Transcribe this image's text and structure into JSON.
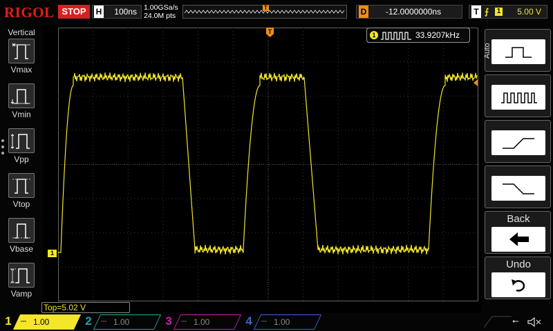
{
  "header": {
    "logo": "RIGOL",
    "run_state": "STOP",
    "horizontal_label": "H",
    "timebase": "100ns",
    "sample_rate": "1.00GSa/s",
    "memory_depth": "24.0M pts",
    "delay_label": "D",
    "delay": "-12.0000000ns",
    "trigger_label": "T",
    "trigger_source": "1",
    "trigger_level": "5.00 V",
    "trigger_marker": "T"
  },
  "measure_panel": {
    "title": "Vertical",
    "items": [
      {
        "label": "Vmax",
        "icon": "vmax-icon"
      },
      {
        "label": "Vmin",
        "icon": "vmin-icon"
      },
      {
        "label": "Vpp",
        "icon": "vpp-icon"
      },
      {
        "label": "Vtop",
        "icon": "vtop-icon"
      },
      {
        "label": "Vbase",
        "icon": "vbase-icon"
      },
      {
        "label": "Vamp",
        "icon": "vamp-icon"
      }
    ]
  },
  "screen": {
    "frequency_channel": "1",
    "frequency": "33.9207kHz",
    "ch1_marker": "1",
    "measurement": "Top=5.02 V"
  },
  "right_menu": {
    "side_label": "Auto",
    "back_label": "Back",
    "undo_label": "Undo"
  },
  "channels": [
    {
      "num": "1",
      "scale": "1.00 V",
      "color": "#f3e62b",
      "active": true
    },
    {
      "num": "2",
      "scale": "1.00 V",
      "color": "#1ea7a0",
      "active": false
    },
    {
      "num": "3",
      "scale": "1.00 V",
      "color": "#c21fb7",
      "active": false
    },
    {
      "num": "4",
      "scale": "1.00 V",
      "color": "#3b62d6",
      "active": false
    }
  ],
  "colors": {
    "ch1": "#f3e62b",
    "trigger": "#f08c14",
    "stop": "#d72020",
    "logo": "#e41b1b"
  }
}
